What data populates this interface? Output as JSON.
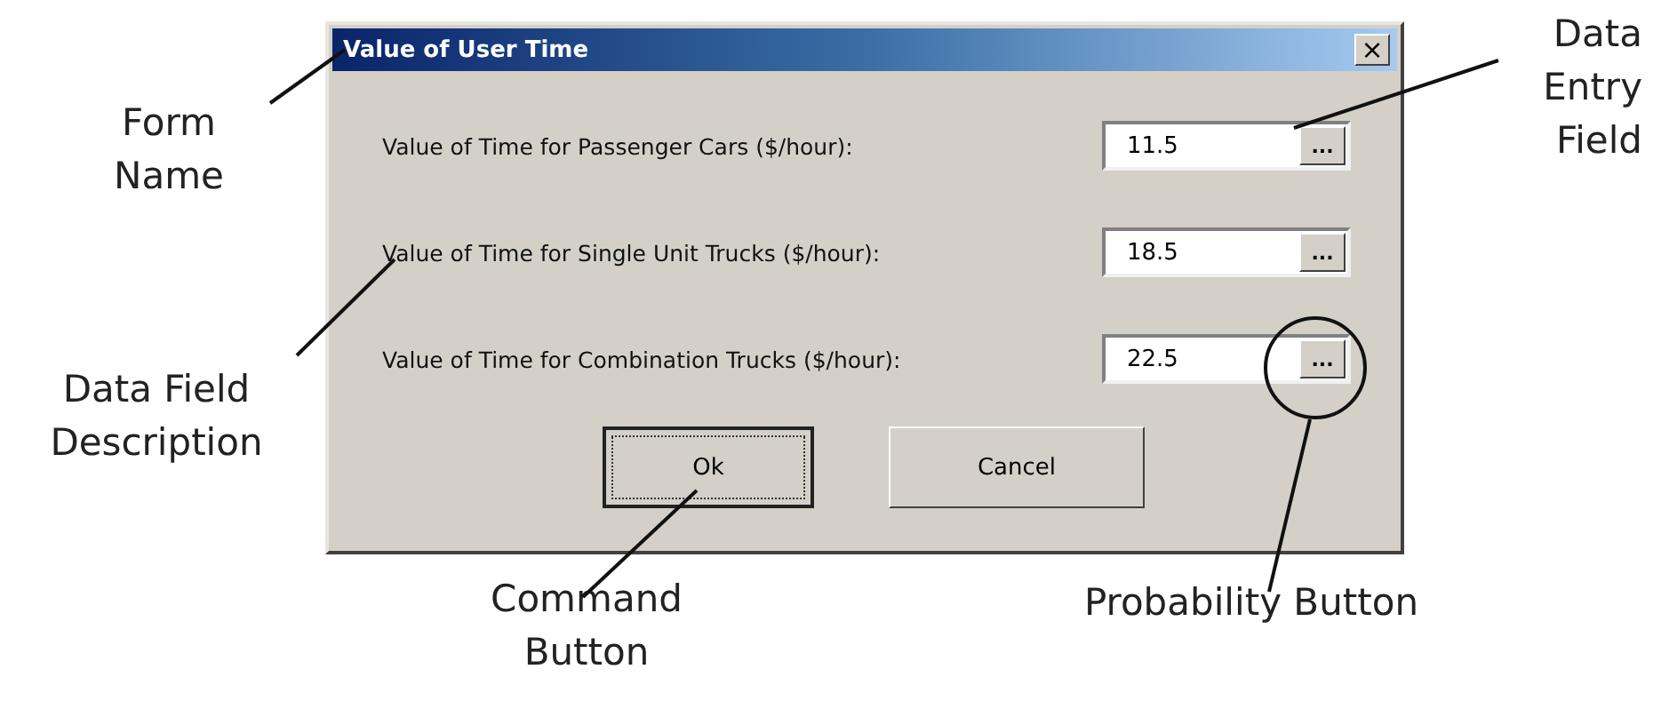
{
  "dialog": {
    "title": "Value of User Time",
    "close": "×",
    "fields": [
      {
        "label": "Value of Time for Passenger Cars ($/hour):",
        "value": "11.5",
        "button": "..."
      },
      {
        "label": "Value of Time for Single Unit Trucks ($/hour):",
        "value": "18.5",
        "button": "..."
      },
      {
        "label": "Value of Time for Combination Trucks ($/hour):",
        "value": "22.5",
        "button": "..."
      }
    ],
    "buttons": [
      {
        "label": "Ok",
        "default": true
      },
      {
        "label": "Cancel",
        "default": false
      }
    ]
  },
  "callouts": [
    {
      "text": "Form Name"
    },
    {
      "text": "Data Entry Field"
    },
    {
      "text": "Data Field Description"
    },
    {
      "text": "Command Button"
    },
    {
      "text": "Probability Button"
    }
  ]
}
